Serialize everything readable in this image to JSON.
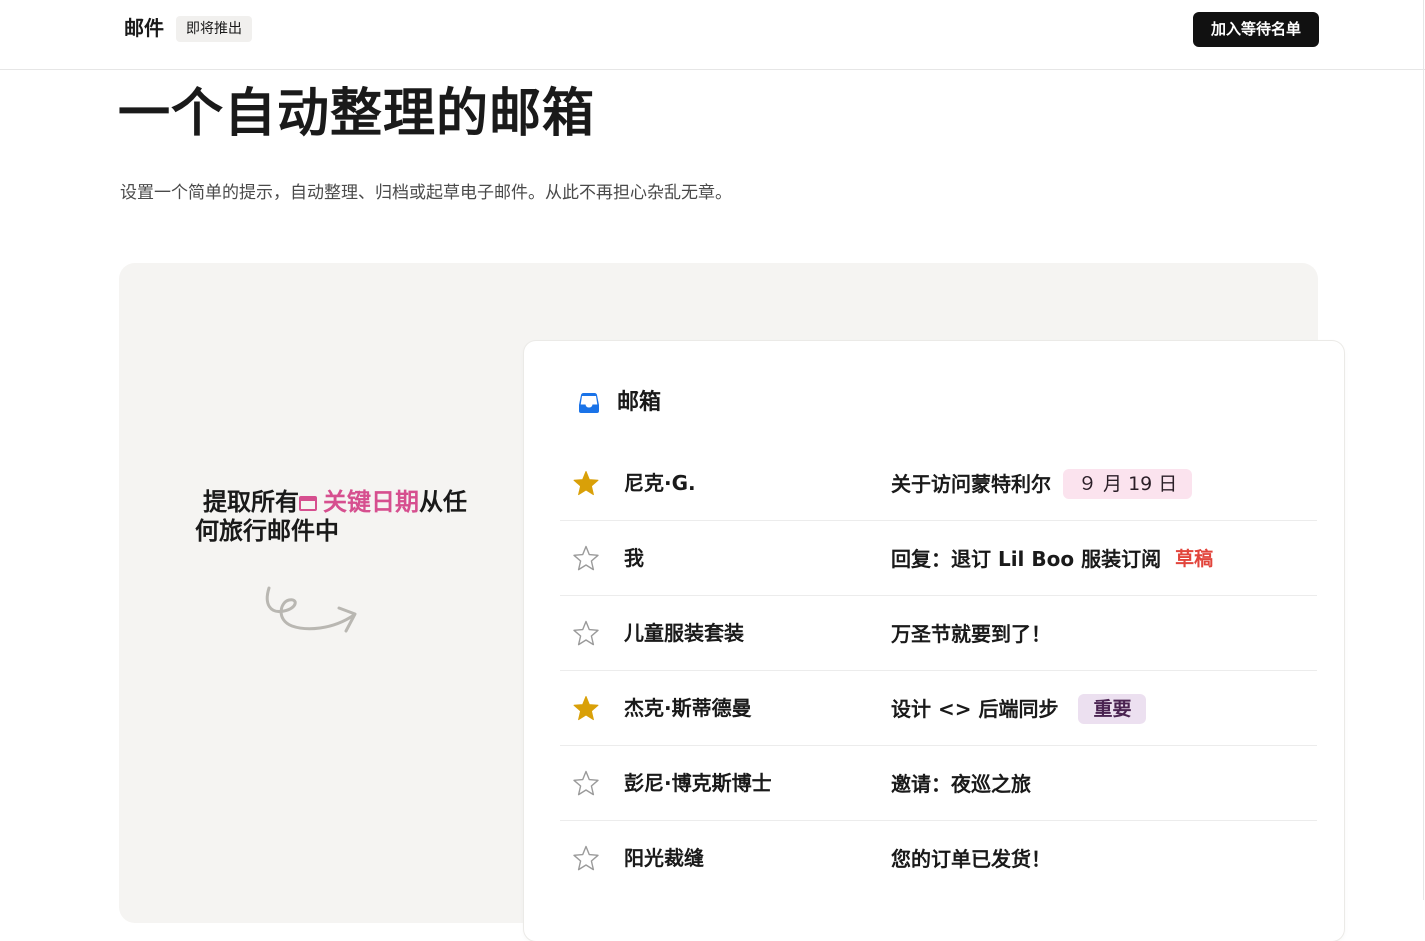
{
  "header": {
    "brand": "邮件",
    "badge": "即将推出",
    "cta_label": "加入等待名单"
  },
  "hero": {
    "title": "一个自动整理的邮箱",
    "subtitle": "设置一个简单的提示，自动整理、归档或起草电子邮件。从此不再担心杂乱无章。"
  },
  "callout": {
    "prefix": "提取所有",
    "highlight": "关键日期",
    "suffix_line1": "从任",
    "line2": "何旅行邮件中",
    "highlight_color": "#d64f8f",
    "icon": "calendar-icon"
  },
  "inbox": {
    "title": "邮箱",
    "icon": "inbox-tray-icon",
    "accent": "#1a73e8",
    "star_color": "#d9a008",
    "emails": [
      {
        "sender": "尼克·G.",
        "subject": "关于访问蒙特利尔",
        "starred": true,
        "tag": "９ 月 19 日",
        "tag_kind": "date"
      },
      {
        "sender": "我",
        "subject": "回复：退订 Lil Boo 服装订阅",
        "starred": false,
        "tag": "草稿",
        "tag_kind": "draft"
      },
      {
        "sender": "儿童服装套装",
        "subject": "万圣节就要到了！",
        "starred": false,
        "tag": "",
        "tag_kind": ""
      },
      {
        "sender": "杰克·斯蒂德曼",
        "subject": "设计 <> 后端同步",
        "starred": true,
        "tag": "重要",
        "tag_kind": "important"
      },
      {
        "sender": "彭尼·博克斯博士",
        "subject": "邀请：夜巡之旅",
        "starred": false,
        "tag": "",
        "tag_kind": ""
      },
      {
        "sender": "阳光裁缝",
        "subject": "您的订单已发货！",
        "starred": false,
        "tag": "",
        "tag_kind": ""
      }
    ]
  }
}
